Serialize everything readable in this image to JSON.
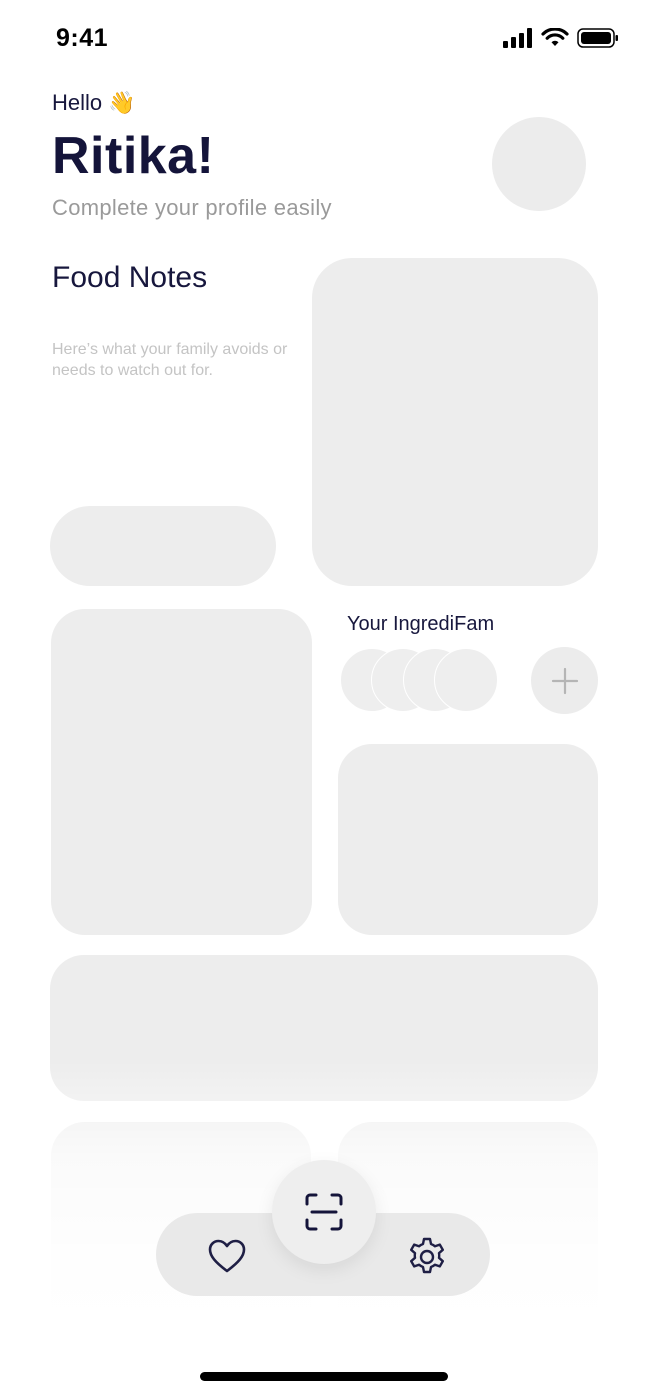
{
  "status_bar": {
    "time": "9:41",
    "icons": [
      "signal-icon",
      "wifi-icon",
      "battery-icon"
    ]
  },
  "header": {
    "greeting": "Hello 👋",
    "name": "Ritika!",
    "subtitle": "Complete your profile easily"
  },
  "food_notes": {
    "title": "Food Notes",
    "description": "Here’s what your family avoids or needs to watch out for."
  },
  "family": {
    "title": "Your IngrediFam",
    "member_count": 4,
    "add_icon": "plus-icon"
  },
  "bottom_nav": {
    "items": [
      "heart-icon",
      "scan-icon",
      "gear-icon"
    ]
  },
  "colors": {
    "placeholder": "#ededed",
    "text_dark": "#14143a",
    "text_muted": "#9a9a9a"
  }
}
